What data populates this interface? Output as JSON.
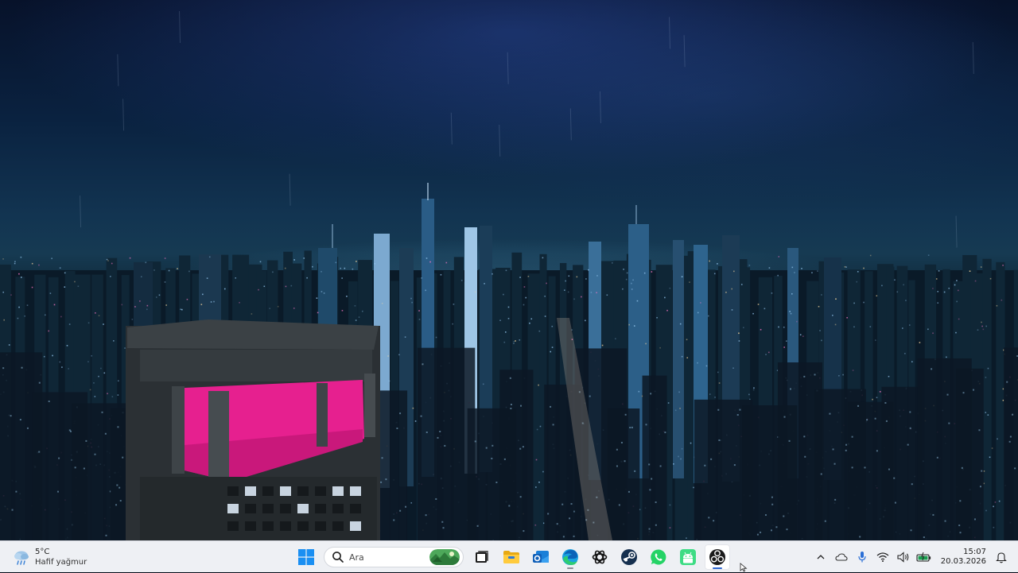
{
  "desktop": {
    "wallpaper": "night-city-skyline-rain"
  },
  "taskbar": {
    "weather": {
      "temperature": "5°C",
      "condition": "Hafif yağmur",
      "icon": "rain-cloud-icon"
    },
    "start_icon": "windows-logo-icon",
    "search": {
      "placeholder": "Ara",
      "icon": "search-icon"
    },
    "pinned_apps": [
      {
        "name": "task-view",
        "icon": "task-view-icon",
        "running": false
      },
      {
        "name": "file-explorer",
        "icon": "folder-icon",
        "running": false
      },
      {
        "name": "outlook",
        "icon": "mail-icon",
        "running": false
      },
      {
        "name": "edge",
        "icon": "edge-icon",
        "running": true
      },
      {
        "name": "chatgpt",
        "icon": "openai-icon",
        "running": false
      },
      {
        "name": "steam",
        "icon": "steam-icon",
        "running": false
      },
      {
        "name": "whatsapp",
        "icon": "whatsapp-icon",
        "running": false
      },
      {
        "name": "android-app",
        "icon": "android-icon",
        "running": false
      },
      {
        "name": "obs-studio",
        "icon": "obs-icon",
        "running": true,
        "active": true
      }
    ],
    "tray": {
      "icons": [
        "chevron-up-icon",
        "cloud-icon",
        "microphone-icon",
        "wifi-icon",
        "speaker-icon",
        "battery-icon"
      ],
      "time": "15:07",
      "date": "20.03.2026",
      "notification_icon": "notification-bell-icon"
    }
  },
  "colors": {
    "taskbar_bg": "#eef0f4",
    "accent": "#2d66d0",
    "windows_blue": "#1e90ff"
  }
}
